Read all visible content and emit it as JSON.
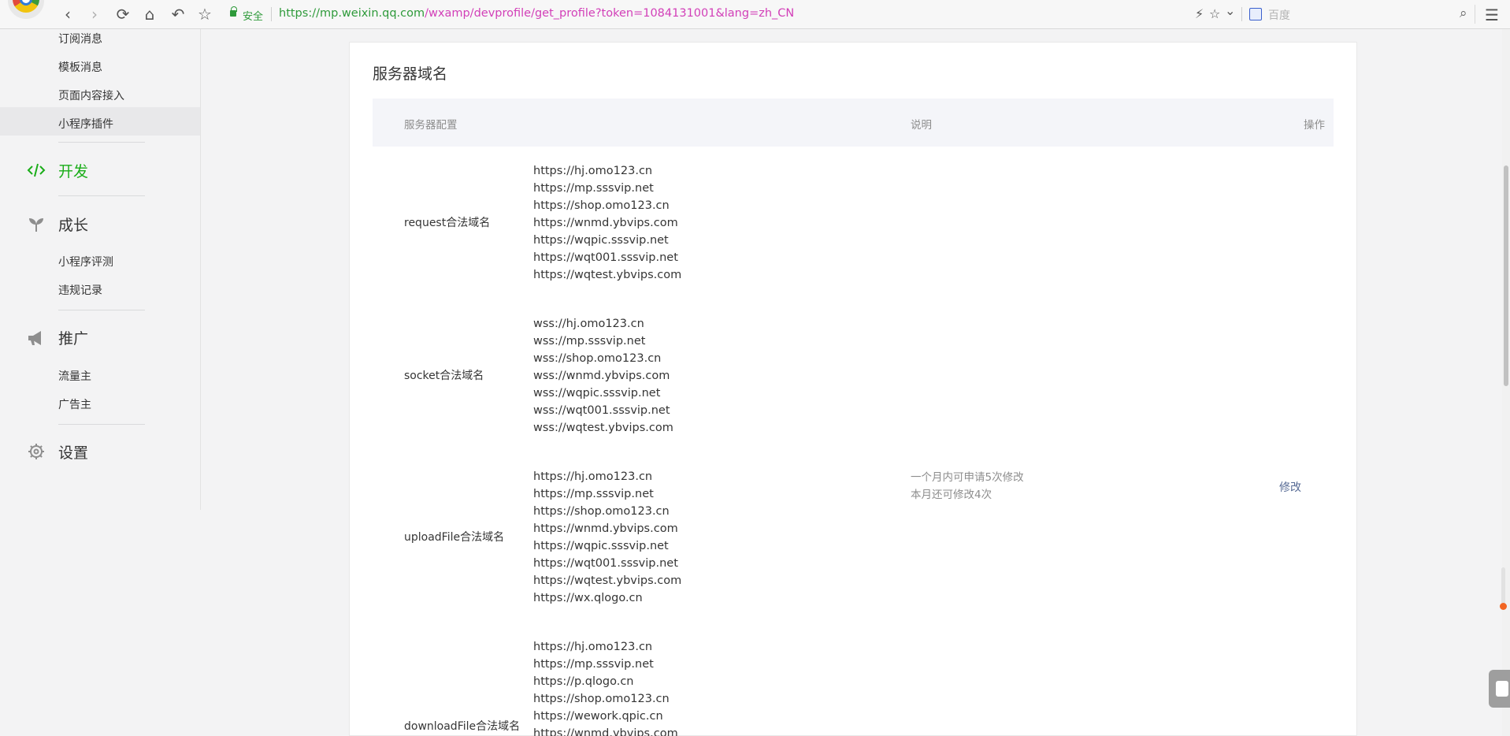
{
  "browser": {
    "url_scheme": "https://",
    "url_host": "mp.weixin.qq.com",
    "url_path": "/wxamp/devprofile/get_profile?token=1084131001&lang=zh_CN",
    "secure_label": "安全",
    "search_placeholder": "百度",
    "icons": {
      "back": "‹",
      "forward": "›",
      "reload": "⟳",
      "home": "⌂",
      "undo": "↶",
      "star": "☆",
      "lightning": "⚡",
      "star_outline": "☆",
      "chevron": "⌄",
      "search": "⌕",
      "menu": "☰"
    }
  },
  "sidebar": {
    "items_top": [
      "订阅消息",
      "模板消息",
      "页面内容接入",
      "小程序插件"
    ],
    "dev": "开发",
    "growth": "成长",
    "growth_items": [
      "小程序评测",
      "违规记录"
    ],
    "promo": "推广",
    "promo_items": [
      "流量主",
      "广告主"
    ],
    "settings": "设置"
  },
  "main": {
    "title": "服务器域名",
    "columns": {
      "config": "服务器配置",
      "desc": "说明",
      "action": "操作"
    },
    "rows": [
      {
        "label": "request合法域名",
        "domains": [
          "https://hj.omo123.cn",
          "https://mp.sssvip.net",
          "https://shop.omo123.cn",
          "https://wnmd.ybvips.com",
          "https://wqpic.sssvip.net",
          "https://wqt001.sssvip.net",
          "https://wqtest.ybvips.com"
        ]
      },
      {
        "label": "socket合法域名",
        "domains": [
          "wss://hj.omo123.cn",
          "wss://mp.sssvip.net",
          "wss://shop.omo123.cn",
          "wss://wnmd.ybvips.com",
          "wss://wqpic.sssvip.net",
          "wss://wqt001.sssvip.net",
          "wss://wqtest.ybvips.com"
        ]
      },
      {
        "label": "uploadFile合法域名",
        "domains": [
          "https://hj.omo123.cn",
          "https://mp.sssvip.net",
          "https://shop.omo123.cn",
          "https://wnmd.ybvips.com",
          "https://wqpic.sssvip.net",
          "https://wqt001.sssvip.net",
          "https://wqtest.ybvips.com",
          "https://wx.qlogo.cn"
        ]
      },
      {
        "label": "downloadFile合法域名",
        "domains": [
          "https://hj.omo123.cn",
          "https://mp.sssvip.net",
          "https://p.qlogo.cn",
          "https://shop.omo123.cn",
          "https://wework.qpic.cn",
          "https://wnmd.ybvips.com"
        ]
      }
    ],
    "desc_lines": [
      "一个月内可申请5次修改",
      "本月还可修改4次"
    ],
    "action_label": "修改"
  }
}
